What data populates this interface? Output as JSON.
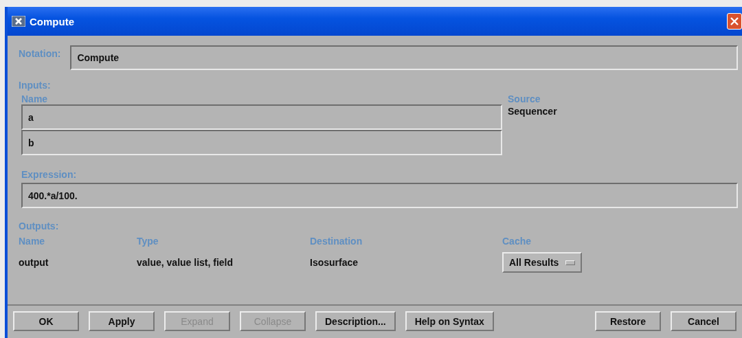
{
  "window": {
    "title": "Compute"
  },
  "notation": {
    "label": "Notation:",
    "value": "Compute"
  },
  "inputs": {
    "label": "Inputs:",
    "columns": [
      "Name",
      "Source"
    ],
    "rows": [
      {
        "name": "a",
        "source": "Sequencer"
      },
      {
        "name": "b"
      }
    ]
  },
  "expression": {
    "label": "Expression:",
    "value": "400.*a/100."
  },
  "outputs": {
    "label": "Outputs:",
    "columns": [
      "Name",
      "Type",
      "Destination",
      "Cache"
    ],
    "rows": [
      {
        "name": "output",
        "type": "value, value list, field",
        "destination": "Isosurface",
        "cache": "All Results"
      }
    ]
  },
  "buttons": [
    {
      "label": "OK",
      "disabled": false
    },
    {
      "label": "Apply",
      "disabled": false
    },
    {
      "label": "Expand",
      "disabled": true
    },
    {
      "label": "Collapse",
      "disabled": true
    },
    {
      "label": "Description...",
      "disabled": false
    },
    {
      "label": "Help on Syntax",
      "disabled": false
    },
    {
      "label": "Restore",
      "disabled": false
    },
    {
      "label": "Cancel",
      "disabled": false
    }
  ]
}
